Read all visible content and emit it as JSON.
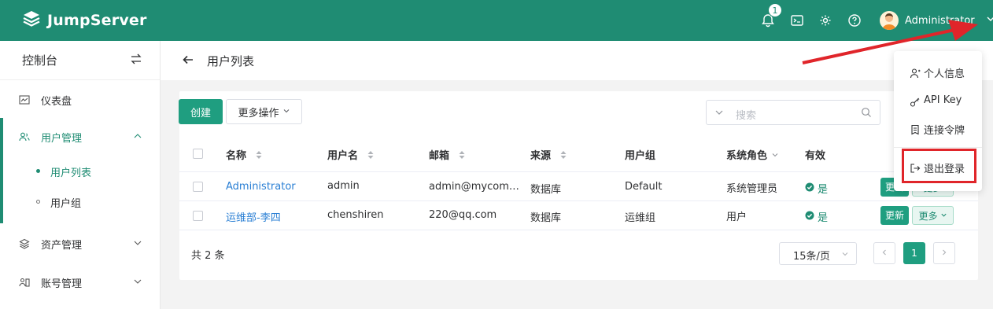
{
  "app": {
    "brand": "JumpServer"
  },
  "header": {
    "notification_count": "1",
    "user_name": "Administrator"
  },
  "sidebar": {
    "title": "控制台",
    "items": [
      {
        "label": "仪表盘"
      },
      {
        "label": "用户管理"
      },
      {
        "label": "资产管理"
      },
      {
        "label": "账号管理"
      }
    ],
    "sub_items": [
      {
        "label": "用户列表"
      },
      {
        "label": "用户组"
      }
    ]
  },
  "page": {
    "title": "用户列表"
  },
  "toolbar": {
    "create_label": "创建",
    "more_actions_label": "更多操作",
    "search_placeholder": "搜索"
  },
  "table": {
    "columns": [
      "名称",
      "用户名",
      "邮箱",
      "来源",
      "用户组",
      "系统角色",
      "有效"
    ],
    "rows": [
      {
        "name": "Administrator",
        "username": "admin",
        "email": "admin@mycom…",
        "source": "数据库",
        "group": "Default",
        "role": "系统管理员",
        "valid": "是",
        "update_label": "更新",
        "more_label": "更多"
      },
      {
        "name": "运维部-李四",
        "username": "chenshiren",
        "email": "220@qq.com",
        "source": "数据库",
        "group": "运维组",
        "role": "用户",
        "valid": "是",
        "update_label": "更新",
        "more_label": "更多"
      }
    ]
  },
  "pagination": {
    "total_text": "共 2 条",
    "page_size": "15条/页",
    "current_page": "1"
  },
  "user_menu": {
    "items": [
      {
        "label": "个人信息"
      },
      {
        "label": "API Key"
      },
      {
        "label": "连接令牌"
      },
      {
        "label": "退出登录"
      }
    ]
  },
  "colors": {
    "primary": "#1f8c73",
    "highlight": "#e0252a",
    "link": "#2a7fd4"
  }
}
